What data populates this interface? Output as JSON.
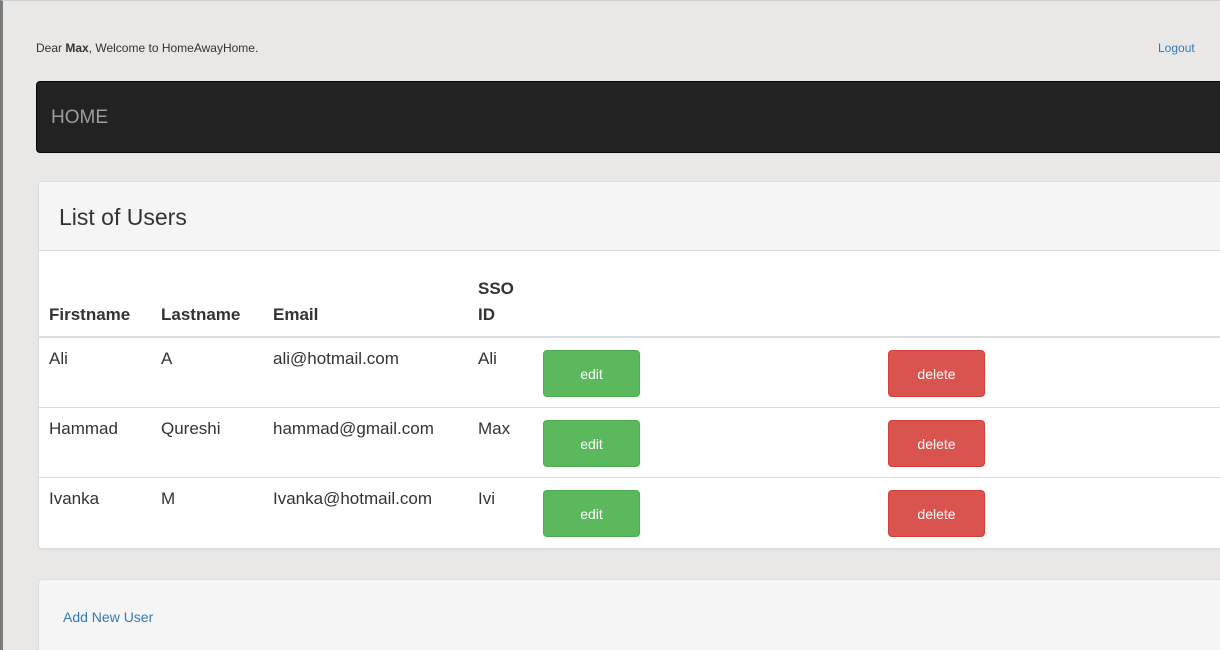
{
  "header": {
    "greeting_prefix": "Dear ",
    "user_name": "Max",
    "greeting_suffix": ", Welcome to HomeAwayHome.",
    "logout_label": "Logout"
  },
  "navbar": {
    "brand": "HOME"
  },
  "users_panel": {
    "title": "List of Users",
    "columns": [
      "Firstname",
      "Lastname",
      "Email",
      "SSO\nID"
    ],
    "rows": [
      {
        "firstname": "Ali",
        "lastname": "A",
        "email": "ali@hotmail.com",
        "sso_id": "Ali",
        "edit_label": "edit",
        "delete_label": "delete"
      },
      {
        "firstname": "Hammad",
        "lastname": "Qureshi",
        "email": "hammad@gmail.com",
        "sso_id": "Max",
        "edit_label": "edit",
        "delete_label": "delete"
      },
      {
        "firstname": "Ivanka",
        "lastname": "M",
        "email": "Ivanka@hotmail.com",
        "sso_id": "Ivi",
        "edit_label": "edit",
        "delete_label": "delete"
      }
    ]
  },
  "footer": {
    "add_user_label": "Add New User"
  },
  "colors": {
    "edit_button": "#5cb85c",
    "delete_button": "#d9534f",
    "link": "#337ab7",
    "navbar": "#222222"
  }
}
